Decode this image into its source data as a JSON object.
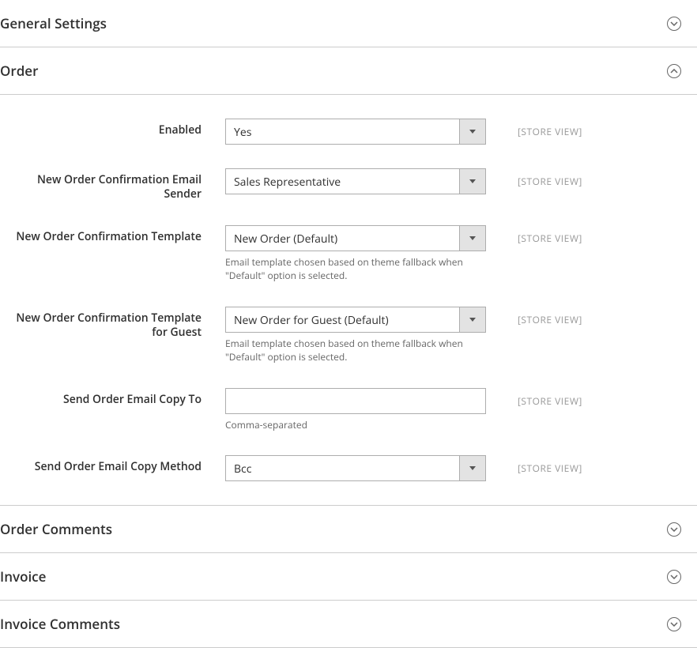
{
  "sections": {
    "general_settings": {
      "title": "General Settings"
    },
    "order": {
      "title": "Order",
      "fields": {
        "enabled": {
          "label": "Enabled",
          "value": "Yes",
          "scope": "[STORE VIEW]"
        },
        "email_sender": {
          "label": "New Order Confirmation Email Sender",
          "value": "Sales Representative",
          "scope": "[STORE VIEW]"
        },
        "template": {
          "label": "New Order Confirmation Template",
          "value": "New Order (Default)",
          "note": "Email template chosen based on theme fallback when \"Default\" option is selected.",
          "scope": "[STORE VIEW]"
        },
        "template_guest": {
          "label": "New Order Confirmation Template for Guest",
          "value": "New Order for Guest (Default)",
          "note": "Email template chosen based on theme fallback when \"Default\" option is selected.",
          "scope": "[STORE VIEW]"
        },
        "copy_to": {
          "label": "Send Order Email Copy To",
          "value": "",
          "note": "Comma-separated",
          "scope": "[STORE VIEW]"
        },
        "copy_method": {
          "label": "Send Order Email Copy Method",
          "value": "Bcc",
          "scope": "[STORE VIEW]"
        }
      }
    },
    "order_comments": {
      "title": "Order Comments"
    },
    "invoice": {
      "title": "Invoice"
    },
    "invoice_comments": {
      "title": "Invoice Comments"
    }
  }
}
